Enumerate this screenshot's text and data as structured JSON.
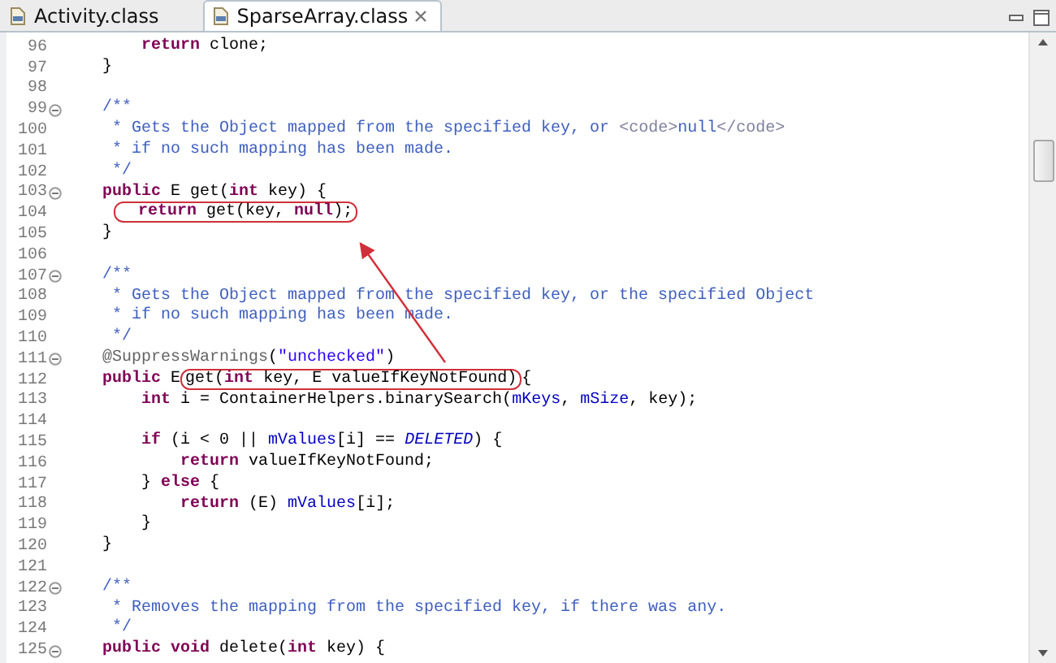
{
  "tabs": [
    {
      "label": "Activity.class",
      "selected": false,
      "closable": false
    },
    {
      "label": "SparseArray.class",
      "selected": true,
      "closable": true
    }
  ],
  "editor": {
    "lines": [
      {
        "number": "96",
        "fold": false,
        "segments": [
          {
            "kind": "keyword",
            "text": "        return"
          },
          {
            "kind": "plain",
            "text": " clone;"
          }
        ]
      },
      {
        "number": "97",
        "fold": false,
        "segments": [
          {
            "kind": "plain",
            "text": "    }"
          }
        ]
      },
      {
        "number": "98",
        "fold": false
      },
      {
        "number": "99",
        "fold": true,
        "segments": [
          {
            "kind": "comment",
            "text": "    /**"
          }
        ]
      },
      {
        "number": "100",
        "fold": false,
        "segments": [
          {
            "kind": "comment",
            "text": "     * Gets the Object mapped from the specified key, or "
          },
          {
            "kind": "tag",
            "text": "<code>"
          },
          {
            "kind": "comment",
            "text": "null"
          },
          {
            "kind": "tag",
            "text": "</code>"
          }
        ]
      },
      {
        "number": "101",
        "fold": false,
        "segments": [
          {
            "kind": "comment",
            "text": "     * if no such mapping has been made."
          }
        ]
      },
      {
        "number": "102",
        "fold": false,
        "segments": [
          {
            "kind": "comment",
            "text": "     */"
          }
        ]
      },
      {
        "number": "103",
        "fold": true,
        "segments": [
          {
            "kind": "keyword",
            "text": "    public"
          },
          {
            "kind": "plain",
            "text": " E get("
          },
          {
            "kind": "keyword",
            "text": "int"
          },
          {
            "kind": "plain",
            "text": " key) {"
          }
        ]
      },
      {
        "number": "104",
        "fold": false,
        "segments": [
          {
            "kind": "circled",
            "segments": [
              {
                "kind": "keyword",
                "text": "        return"
              },
              {
                "kind": "plain",
                "text": " get(key, "
              },
              {
                "kind": "keyword",
                "text": "null"
              },
              {
                "kind": "plain",
                "text": ");"
              }
            ]
          }
        ]
      },
      {
        "number": "105",
        "fold": false,
        "segments": [
          {
            "kind": "plain",
            "text": "    }"
          }
        ]
      },
      {
        "number": "106",
        "fold": false
      },
      {
        "number": "107",
        "fold": true,
        "segments": [
          {
            "kind": "comment",
            "text": "    /**"
          }
        ]
      },
      {
        "number": "108",
        "fold": false,
        "segments": [
          {
            "kind": "comment",
            "text": "     * Gets the Object mapped from the specified key, or the specified Object"
          }
        ]
      },
      {
        "number": "109",
        "fold": false,
        "segments": [
          {
            "kind": "comment",
            "text": "     * if no such mapping has been made."
          }
        ]
      },
      {
        "number": "110",
        "fold": false,
        "segments": [
          {
            "kind": "comment",
            "text": "     */"
          }
        ]
      },
      {
        "number": "111",
        "fold": true,
        "segments": [
          {
            "kind": "annotation",
            "text": "    @SuppressWarnings"
          },
          {
            "kind": "plain",
            "text": "("
          },
          {
            "kind": "string",
            "text": "\"unchecked\""
          },
          {
            "kind": "plain",
            "text": ")"
          }
        ]
      },
      {
        "number": "112",
        "fold": false,
        "segments": [
          {
            "kind": "keyword",
            "text": "    public"
          },
          {
            "kind": "plain",
            "text": " E"
          },
          {
            "kind": "circled",
            "segments": [
              {
                "kind": "plain",
                "text": "get("
              },
              {
                "kind": "keyword",
                "text": "int"
              },
              {
                "kind": "plain",
                "text": " key, E valueIfKeyNotFound)"
              }
            ]
          },
          {
            "kind": "plain",
            "text": "{"
          }
        ]
      },
      {
        "number": "113",
        "fold": false,
        "segments": [
          {
            "kind": "keyword",
            "text": "        int"
          },
          {
            "kind": "plain",
            "text": " i = ContainerHelpers.binarySearch("
          },
          {
            "kind": "field",
            "text": "mKeys"
          },
          {
            "kind": "plain",
            "text": ", "
          },
          {
            "kind": "field",
            "text": "mSize"
          },
          {
            "kind": "plain",
            "text": ", key);"
          }
        ]
      },
      {
        "number": "114",
        "fold": false
      },
      {
        "number": "115",
        "fold": false,
        "segments": [
          {
            "kind": "keyword",
            "text": "        if"
          },
          {
            "kind": "plain",
            "text": " (i < 0 || "
          },
          {
            "kind": "field",
            "text": "mValues"
          },
          {
            "kind": "plain",
            "text": "[i] == "
          },
          {
            "kind": "constant",
            "text": "DELETED"
          },
          {
            "kind": "plain",
            "text": ") {"
          }
        ]
      },
      {
        "number": "116",
        "fold": false,
        "segments": [
          {
            "kind": "keyword",
            "text": "            return"
          },
          {
            "kind": "plain",
            "text": " valueIfKeyNotFound;"
          }
        ]
      },
      {
        "number": "117",
        "fold": false,
        "segments": [
          {
            "kind": "plain",
            "text": "        } "
          },
          {
            "kind": "keyword",
            "text": "else"
          },
          {
            "kind": "plain",
            "text": " {"
          }
        ]
      },
      {
        "number": "118",
        "fold": false,
        "segments": [
          {
            "kind": "keyword",
            "text": "            return"
          },
          {
            "kind": "plain",
            "text": " (E) "
          },
          {
            "kind": "field",
            "text": "mValues"
          },
          {
            "kind": "plain",
            "text": "[i];"
          }
        ]
      },
      {
        "number": "119",
        "fold": false,
        "segments": [
          {
            "kind": "plain",
            "text": "        }"
          }
        ]
      },
      {
        "number": "120",
        "fold": false,
        "segments": [
          {
            "kind": "plain",
            "text": "    }"
          }
        ]
      },
      {
        "number": "121",
        "fold": false
      },
      {
        "number": "122",
        "fold": true,
        "segments": [
          {
            "kind": "comment",
            "text": "    /**"
          }
        ]
      },
      {
        "number": "123",
        "fold": false,
        "segments": [
          {
            "kind": "comment",
            "text": "     * Removes the mapping from the specified key, if there was any."
          }
        ]
      },
      {
        "number": "124",
        "fold": false,
        "segments": [
          {
            "kind": "comment",
            "text": "     */"
          }
        ]
      },
      {
        "number": "125",
        "fold": true,
        "segments": [
          {
            "kind": "keyword",
            "text": "    public void"
          },
          {
            "kind": "plain",
            "text": " delete("
          },
          {
            "kind": "keyword",
            "text": "int"
          },
          {
            "kind": "plain",
            "text": " key) {"
          }
        ]
      }
    ]
  }
}
